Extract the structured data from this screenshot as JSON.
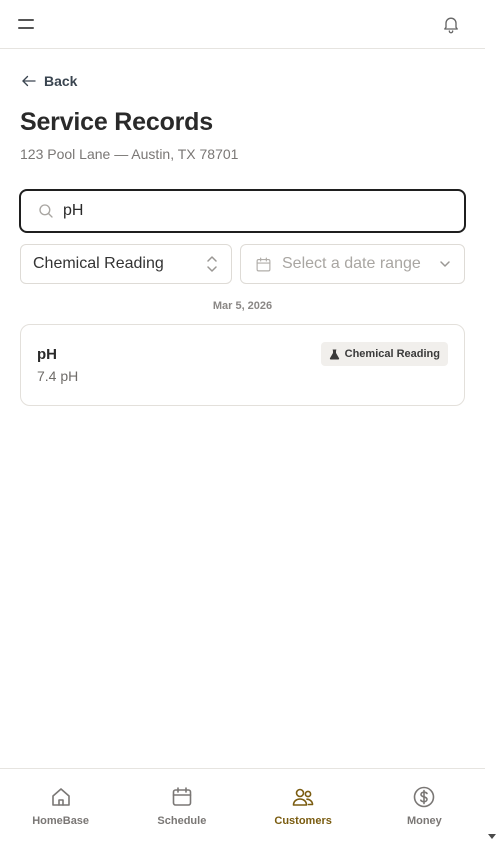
{
  "header": {
    "menu_icon": "hamburger-menu-icon",
    "bell_icon": "bell-icon"
  },
  "back": {
    "label": "Back",
    "icon": "arrow-left-icon"
  },
  "page": {
    "title": "Service Records",
    "address": "123 Pool Lane — Austin, TX 78701"
  },
  "search": {
    "value": "pH",
    "icon": "search-icon"
  },
  "filters": {
    "type_selected": "Chemical Reading",
    "date_placeholder": "Select a date range"
  },
  "records": {
    "group_date": "Mar 5, 2026",
    "items": [
      {
        "title": "pH",
        "value": "7.4 pH",
        "badge": "Chemical Reading",
        "badge_icon": "flask-icon"
      }
    ]
  },
  "nav": {
    "items": [
      {
        "label": "HomeBase",
        "icon": "home-icon"
      },
      {
        "label": "Schedule",
        "icon": "calendar-icon"
      },
      {
        "label": "Customers",
        "icon": "users-icon",
        "active": true
      },
      {
        "label": "Money",
        "icon": "dollar-circle-icon"
      }
    ]
  },
  "colors": {
    "accent": "#7a5c10",
    "border": "#e3e0db",
    "text": "#2a2a2a",
    "muted": "#7a7775"
  }
}
